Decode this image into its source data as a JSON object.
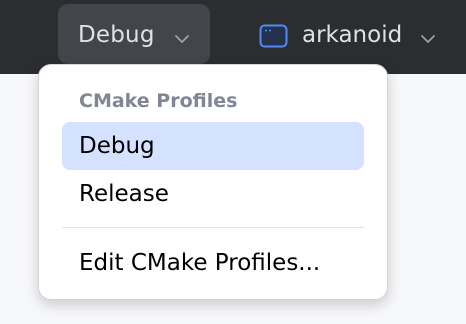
{
  "toolbar": {
    "config_label": "Debug",
    "project_label": "arkanoid",
    "project_icon": "project-window-icon",
    "chevron_icon": "chevron-down-icon"
  },
  "dropdown": {
    "header": "CMake Profiles",
    "items": [
      {
        "label": "Debug",
        "selected": true
      },
      {
        "label": "Release",
        "selected": false
      }
    ],
    "edit_label": "Edit CMake Profiles..."
  },
  "colors": {
    "toolbar_bg": "#2b2d30",
    "active_button_bg": "#43454a",
    "selection_bg": "#d4e2ff",
    "project_icon_accent": "#548af7"
  }
}
